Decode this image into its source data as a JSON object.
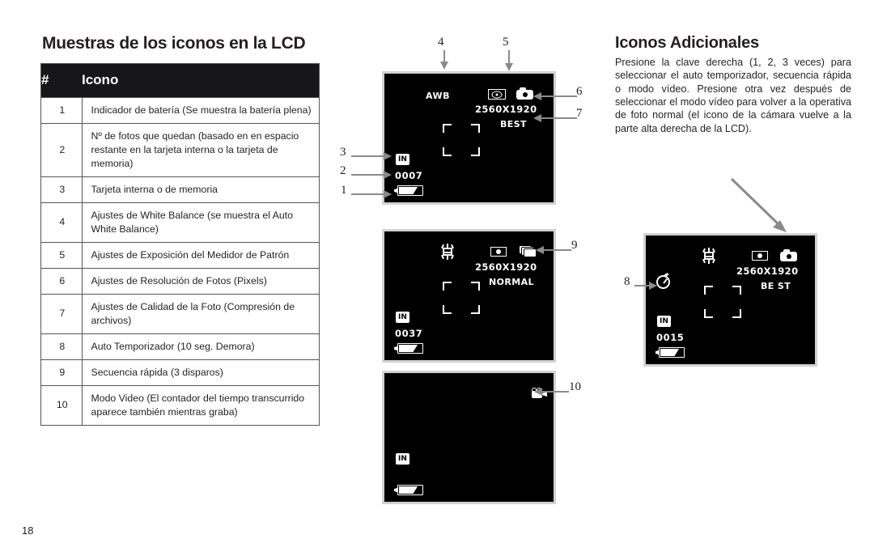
{
  "page_number": "18",
  "left": {
    "title": "Muestras de los iconos en la LCD",
    "table": {
      "headers": [
        "#",
        "Icono"
      ],
      "rows": [
        {
          "num": "1",
          "desc": "Indicador de batería\n(Se muestra la batería plena)"
        },
        {
          "num": "2",
          "desc": "Nº de fotos que quedan (basado en en espacio restante en la tarjeta interna o la tarjeta de memoria)"
        },
        {
          "num": "3",
          "desc": "Tarjeta interna o de memoria"
        },
        {
          "num": "4",
          "desc": "Ajustes de White Balance (se muestra el Auto White Balance)"
        },
        {
          "num": "5",
          "desc": "Ajustes de Exposición del Medidor de Patrón"
        },
        {
          "num": "6",
          "desc": "Ajustes de Resolución de Fotos (Pixels)"
        },
        {
          "num": "7",
          "desc": "Ajustes de Calidad de la Foto (Compresión de archivos)"
        },
        {
          "num": "8",
          "desc": "Auto Temporizador (10 seg. Demora)"
        },
        {
          "num": "9",
          "desc": "Secuencia rápida (3 disparos)"
        },
        {
          "num": "10",
          "desc": "Modo Video (El contador del tiempo transcurrido aparece también mientras graba)"
        }
      ]
    }
  },
  "right": {
    "title": "Iconos Adicionales",
    "body": "Presione la clave derecha (1, 2, 3 veces) para seleccionar el auto temporizador, secuencia rápida o modo vídeo. Presione otra vez después de seleccionar el modo vídeo para volver a la operativa de foto normal (el icono de la cámara vuelve a la parte alta derecha de la LCD)."
  },
  "lcd1": {
    "white_balance": "AWB",
    "resolution": "2560X1920",
    "quality": "BEST",
    "card": "IN",
    "counter": "0007",
    "callouts": [
      "1",
      "2",
      "3",
      "4",
      "5",
      "6",
      "7"
    ]
  },
  "lcd2": {
    "resolution": "2560X1920",
    "quality": "NORMAL",
    "card": "IN",
    "counter": "0037",
    "callouts": [
      "9"
    ]
  },
  "lcd3": {
    "card": "IN",
    "callouts": [
      "10"
    ]
  },
  "lcd4": {
    "resolution": "2560X1920",
    "quality": "BE ST",
    "card": "IN",
    "counter": "0015",
    "callouts": [
      "8"
    ]
  },
  "colors": {
    "header_bg": "#17171a",
    "text": "#231f20",
    "lcd_bg": "#000000",
    "lcd_border": "#d2d2d2",
    "leader": "#8a8a8a"
  }
}
